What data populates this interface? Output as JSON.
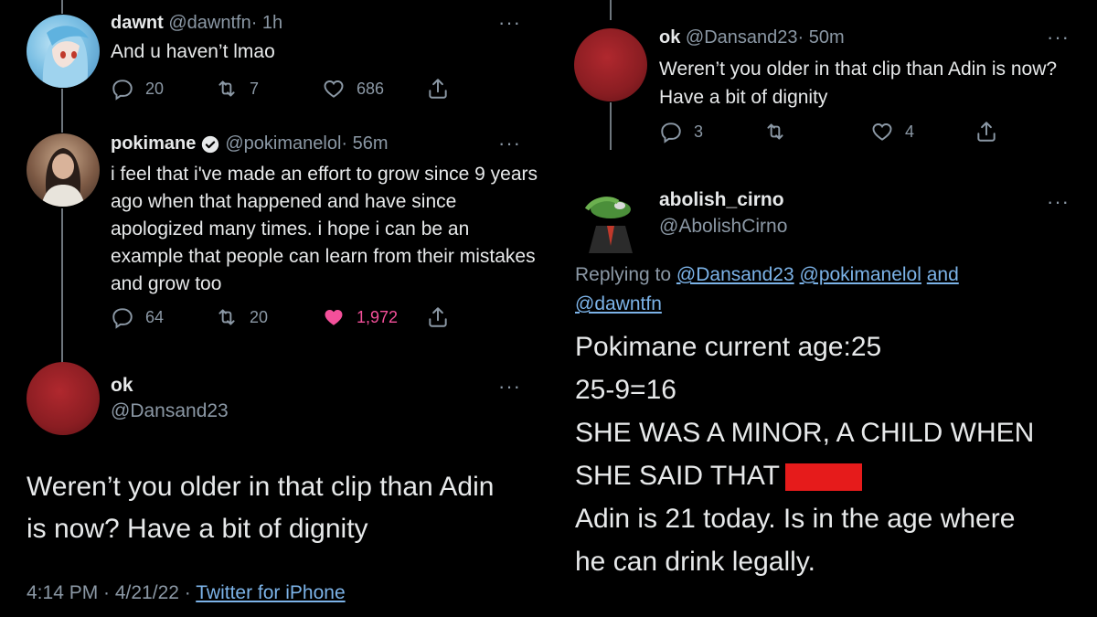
{
  "left": {
    "tweet1": {
      "name": "dawnt",
      "handle": "@dawntfn",
      "time": "· 1h",
      "text": "And u haven’t lmao",
      "replies": "20",
      "retweets": "7",
      "likes": "686"
    },
    "tweet2": {
      "name": "pokimane",
      "handle": "@pokimanelol",
      "time": "· 56m",
      "text": "i feel that i've made an effort to grow since 9 years ago when that happened and have since apologized many times. i hope i can be an example that people can learn from their mistakes and grow too",
      "replies": "64",
      "retweets": "20",
      "likes": "1,972"
    },
    "tweet3": {
      "name": "ok",
      "handle": "@Dansand23",
      "text": "Weren’t you older in that clip than Adin is now? Have a bit of dignity",
      "timestamp": "4:14 PM · 4/21/22 ·",
      "source": "Twitter for iPhone"
    }
  },
  "right": {
    "tweet1": {
      "name": "ok",
      "handle": "@Dansand23",
      "time": "· 50m",
      "text": "Weren’t you older in that clip than Adin is now? Have a bit of dignity",
      "replies": "3",
      "retweets": "",
      "likes": "4"
    },
    "tweet2": {
      "name": "abolish_cirno",
      "handle": "@AbolishCirno",
      "replying_prefix": "Replying to",
      "mention1": "@Dansand23",
      "mention2": "@pokimanelol",
      "mention_and": "and",
      "mention3": "@dawntfn",
      "line1": "Pokimane current age:25",
      "line2": "25-9=16",
      "line3": "SHE WAS A MINOR, A CHILD WHEN",
      "line4": "SHE SAID THAT",
      "line5": "Adin is 21 today. Is in the age where",
      "line6": "he can drink legally."
    }
  },
  "icons": {
    "more": "more-icon",
    "reply": "reply-icon",
    "retweet": "retweet-icon",
    "like": "heart-icon",
    "share": "share-icon"
  },
  "colors": {
    "background": "#000000",
    "muted": "#8b98a5",
    "link": "#7cb3e8",
    "liked": "#f4509a",
    "redaction": "#e61b1b",
    "verified": "#e7e9ea"
  }
}
